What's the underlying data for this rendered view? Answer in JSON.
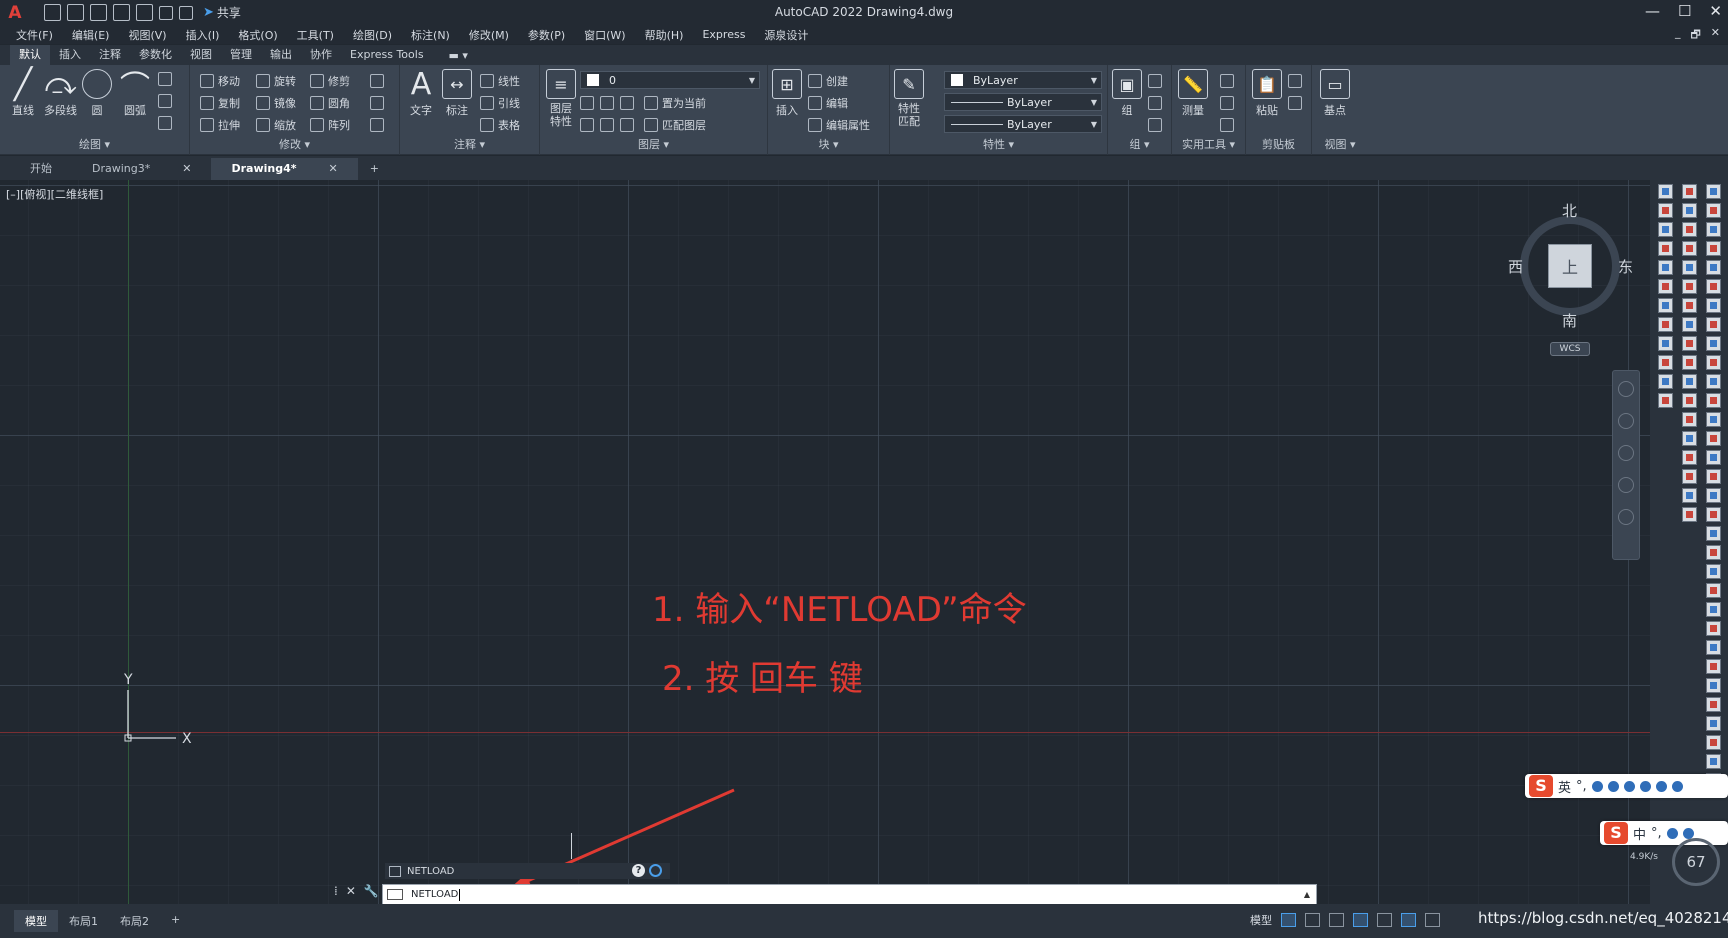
{
  "titlebar": {
    "app_logo": "A",
    "share": "共享",
    "title": "AutoCAD 2022    Drawing4.dwg",
    "minimize": "—",
    "maximize": "☐",
    "close": "✕"
  },
  "menubar": {
    "items": [
      "文件(F)",
      "编辑(E)",
      "视图(V)",
      "插入(I)",
      "格式(O)",
      "工具(T)",
      "绘图(D)",
      "标注(N)",
      "修改(M)",
      "参数(P)",
      "窗口(W)",
      "帮助(H)",
      "Express",
      "源泉设计"
    ],
    "inner_min": "_",
    "inner_restore": "🗗",
    "inner_close": "✕"
  },
  "ribbon_tabs": {
    "items": [
      "默认",
      "插入",
      "注释",
      "参数化",
      "视图",
      "管理",
      "输出",
      "协作",
      "Express Tools"
    ],
    "active_index": 0
  },
  "ribbon": {
    "draw": {
      "title": "绘图 ▾",
      "line": "直线",
      "polyline": "多段线",
      "circle": "圆",
      "arc": "圆弧"
    },
    "modify": {
      "title": "修改 ▾",
      "move": "移动",
      "rotate": "旋转",
      "trim": "修剪",
      "copy": "复制",
      "mirror": "镜像",
      "fillet": "圆角",
      "stretch": "拉伸",
      "scale": "缩放",
      "array": "阵列"
    },
    "annotation": {
      "title": "注释 ▾",
      "text": "文字",
      "dimension": "标注",
      "linear": "线性",
      "leader": "引线",
      "table": "表格"
    },
    "layers": {
      "title": "图层 ▾",
      "layer_props": "图层\n特性",
      "layer_name": "0",
      "make_current": "置为当前",
      "match_layer": "匹配图层"
    },
    "block": {
      "title": "块 ▾",
      "insert": "插入",
      "create": "创建",
      "edit": "编辑",
      "edit_attr": "编辑属性"
    },
    "properties": {
      "title": "特性 ▾",
      "match": "特性\n匹配",
      "color": "ByLayer",
      "linetype": "ByLayer",
      "lineweight": "ByLayer"
    },
    "groups": {
      "title": "组 ▾",
      "group": "组"
    },
    "utilities": {
      "title": "实用工具 ▾",
      "measure": "测量"
    },
    "clipboard": {
      "title": "剪贴板",
      "paste": "粘贴"
    },
    "view": {
      "title": "视图 ▾",
      "base": "基点"
    }
  },
  "filetabs": {
    "start": "开始",
    "tabs": [
      {
        "label": "Drawing3*",
        "close": "✕"
      },
      {
        "label": "Drawing4*",
        "close": "✕"
      }
    ],
    "add": "+"
  },
  "canvas": {
    "view_label": "[–][俯视][二维线框]",
    "ucs_y": "Y",
    "ucs_x": "X"
  },
  "viewcube": {
    "north": "北",
    "south": "南",
    "east": "东",
    "west": "西",
    "top_face": "上",
    "wcs": "WCS"
  },
  "annotations": {
    "step1": "1. 输入“NETLOAD”命令",
    "step2": "2. 按 回车 键"
  },
  "command": {
    "history": "NETLOAD",
    "input_value": "NETLOAD",
    "help": "?",
    "close": "✕"
  },
  "statusbar": {
    "layouts": [
      "模型",
      "布局1",
      "布局2"
    ],
    "add_layout": "+",
    "model_label": "模型"
  },
  "watermark": "https://blog.csdn.net/eq_40282149",
  "ime": {
    "logo": "S",
    "lang_en": "英",
    "lang_zh": "中",
    "punct": "°,",
    "speed": "4.9K/s",
    "percent": "67"
  },
  "colors": {
    "annotation_red": "#e03a32",
    "accent_blue": "#4a9eea"
  }
}
